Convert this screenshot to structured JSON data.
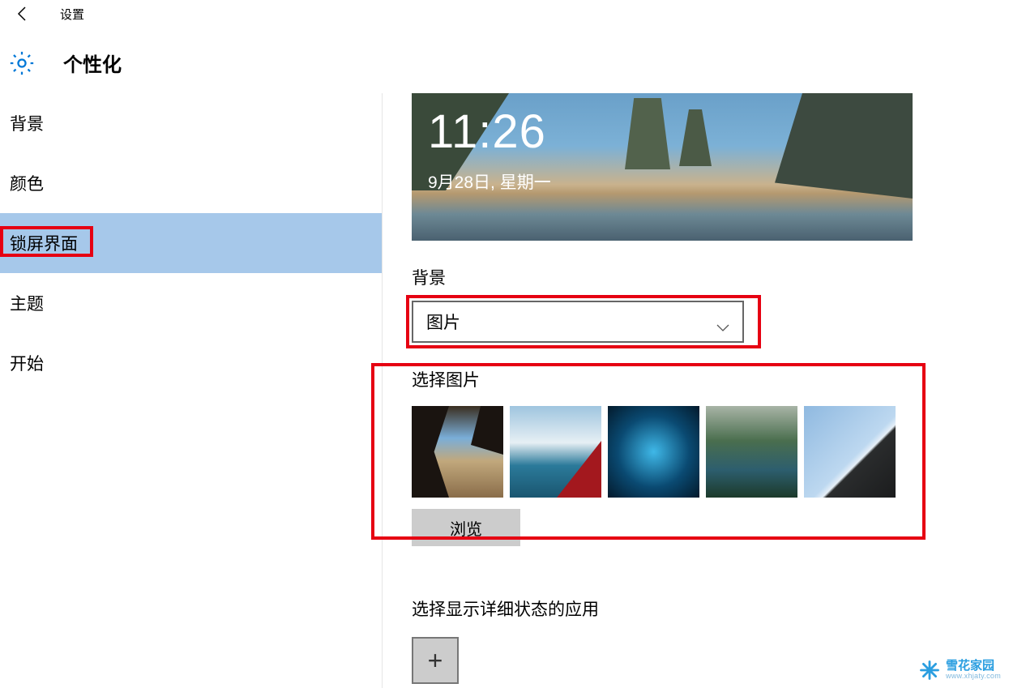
{
  "header": {
    "back_title": "设置"
  },
  "subheader": {
    "title": "个性化"
  },
  "sidebar": {
    "items": [
      {
        "label": "背景"
      },
      {
        "label": "颜色"
      },
      {
        "label": "锁屏界面",
        "active": true
      },
      {
        "label": "主题"
      },
      {
        "label": "开始"
      }
    ]
  },
  "preview": {
    "time": "11:26",
    "date": "9月28日, 星期一"
  },
  "background_section": {
    "label": "背景",
    "dropdown_value": "图片"
  },
  "choose_image": {
    "label": "选择图片",
    "browse_label": "浏览",
    "thumbs": [
      "beach-cave",
      "aerial-sea",
      "ice-cave",
      "mountain-lake",
      "hill-sky"
    ]
  },
  "detail_status": {
    "label": "选择显示详细状态的应用"
  },
  "watermark": {
    "name": "雪花家园",
    "url": "www.xhjaty.com"
  },
  "colors": {
    "highlight_red": "#e60012",
    "active_blue": "#a6c8ea",
    "accent_blue": "#2a9ee0"
  }
}
